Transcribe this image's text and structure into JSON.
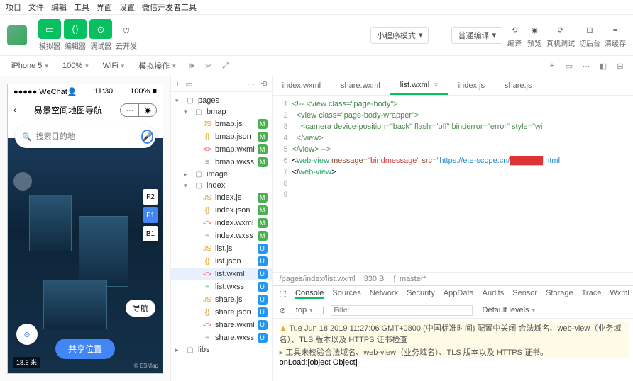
{
  "menu": [
    "项目",
    "文件",
    "编辑",
    "工具",
    "界面",
    "设置",
    "微信开发者工具"
  ],
  "toolbar": {
    "simulator": "模拟器",
    "editor": "编辑器",
    "debugger": "调试器",
    "cloud": "云开发",
    "mode_label": "小程序模式",
    "compile_label": "普通编译",
    "compile_btn": "编译",
    "preview_btn": "预览",
    "remote_btn": "真机调试",
    "background_btn": "切后台",
    "clear_btn": "清缓存"
  },
  "subbar": {
    "device": "iPhone 5",
    "zoom": "100%",
    "network": "WiFi",
    "action": "模拟操作"
  },
  "simulator": {
    "carrier": "WeChat👤",
    "time": "11:30",
    "battery": "100%",
    "title": "易景空间地图导航",
    "search_placeholder": "搜索目的地",
    "floor_f2": "F2",
    "floor_f1": "F1",
    "floor_b1": "B1",
    "nav_label": "导航",
    "share_label": "共享位置",
    "scale": "18.6 米",
    "credit": "© ESMap"
  },
  "tree": [
    {
      "d": 0,
      "arr": "▾",
      "ic": "folder",
      "name": "pages"
    },
    {
      "d": 1,
      "arr": "▾",
      "ic": "folder",
      "name": "bmap"
    },
    {
      "d": 2,
      "ic": "js",
      "name": "bmap.js",
      "b": "M"
    },
    {
      "d": 2,
      "ic": "json",
      "name": "bmap.json",
      "b": "M"
    },
    {
      "d": 2,
      "ic": "wxml",
      "name": "bmap.wxml",
      "b": "M"
    },
    {
      "d": 2,
      "ic": "wxss",
      "name": "bmap.wxss",
      "b": "M"
    },
    {
      "d": 1,
      "arr": "▸",
      "ic": "folder",
      "name": "image"
    },
    {
      "d": 1,
      "arr": "▾",
      "ic": "folder",
      "name": "index"
    },
    {
      "d": 2,
      "ic": "js",
      "name": "index.js",
      "b": "M"
    },
    {
      "d": 2,
      "ic": "json",
      "name": "index.json",
      "b": "M"
    },
    {
      "d": 2,
      "ic": "wxml",
      "name": "index.wxml",
      "b": "M"
    },
    {
      "d": 2,
      "ic": "wxss",
      "name": "index.wxss",
      "b": "M"
    },
    {
      "d": 2,
      "ic": "js",
      "name": "list.js",
      "b": "U"
    },
    {
      "d": 2,
      "ic": "json",
      "name": "list.json",
      "b": "U"
    },
    {
      "d": 2,
      "ic": "wxml",
      "name": "list.wxml",
      "b": "U",
      "sel": true
    },
    {
      "d": 2,
      "ic": "wxss",
      "name": "list.wxss",
      "b": "U"
    },
    {
      "d": 2,
      "ic": "js",
      "name": "share.js",
      "b": "U"
    },
    {
      "d": 2,
      "ic": "json",
      "name": "share.json",
      "b": "U"
    },
    {
      "d": 2,
      "ic": "wxml",
      "name": "share.wxml",
      "b": "U"
    },
    {
      "d": 2,
      "ic": "wxss",
      "name": "share.wxss",
      "b": "U"
    },
    {
      "d": 0,
      "arr": "▸",
      "ic": "folder",
      "name": "libs"
    }
  ],
  "editor_tabs": [
    {
      "name": "index.wxml"
    },
    {
      "name": "share.wxml"
    },
    {
      "name": "list.wxml",
      "active": true,
      "close": true
    },
    {
      "name": "index.js"
    },
    {
      "name": "share.js"
    }
  ],
  "code": {
    "l1": "<!-- <view class=\"page-body\">",
    "l2": "  <view class=\"page-body-wrapper\">",
    "l3a": "    <camera device-position=",
    "l3b": "\"back\"",
    "l3c": " flash=",
    "l3d": "\"off\"",
    "l3e": " binderror=",
    "l3f": "\"error\"",
    "l3g": " style=",
    "l3h": "\"wi",
    "l4": "  </view>",
    "l5": "</view> -->",
    "l6a": "<",
    "l6tag": "web-view",
    "l6b": " message=",
    "l6msg": "\"bindmessage\"",
    "l6c": " src=",
    "l6url": "\"https://e.e-scope.cn/",
    "l6red": "██████",
    "l6end": ".html",
    "l7": "</web-view>"
  },
  "statusbar": {
    "path": "/pages/index/list.wxml",
    "size": "330 B",
    "branch": "master*"
  },
  "devtools": {
    "tabs": [
      "Console",
      "Sources",
      "Network",
      "Security",
      "AppData",
      "Audits",
      "Sensor",
      "Storage",
      "Trace",
      "Wxml"
    ],
    "filter_top": "top",
    "filter_placeholder": "Filter",
    "filter_level": "Default levels",
    "log1": "Tue Jun 18 2019 11:27:06 GMT+0800 (中国标准时间) 配置中关闭 合法域名、web-view（业务域名）、TLS 版本以及 HTTPS 证书检查",
    "log2": "工具未校验合法域名、web-view（业务域名）、TLS 版本以及 HTTPS 证书。",
    "log3": "onLoad:[object Object]"
  }
}
